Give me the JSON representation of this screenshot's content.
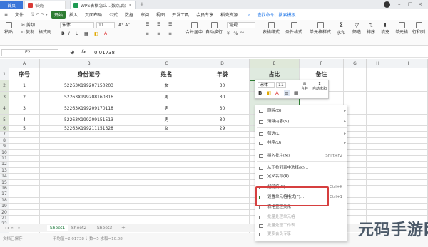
{
  "titlebar": {
    "home_tab": "首页",
    "doc_tab": "稻壳",
    "active_tab": "WPS表格怎么...数点后两位小数"
  },
  "menubar": {
    "file": "文件",
    "items": [
      "开始",
      "插入",
      "页面布局",
      "公式",
      "数据",
      "审阅",
      "视图",
      "开发工具",
      "会员专享",
      "稻壳资源"
    ],
    "active": "开始",
    "search": "查找命令、搜索模板"
  },
  "ribbon": {
    "paste": "粘贴",
    "cut": "剪切",
    "copy": "复制",
    "format_painter": "格式刷",
    "font_name": "宋体",
    "font_size": "11",
    "merge_center": "合并居中",
    "wrap_text": "自动换行",
    "number_format": "常规",
    "table_style": "表格样式",
    "cond_format": "条件格式",
    "cell_style": "单元格样式",
    "sum": "求和",
    "filter": "筛选",
    "sort": "排序",
    "fill": "填充",
    "cell": "单元格",
    "row_col": "行和列",
    "worksheet": "工作表"
  },
  "formula_bar": {
    "cell_ref": "E2",
    "fx": "fx",
    "value": "0.01738"
  },
  "grid": {
    "columns": [
      "A",
      "B",
      "C",
      "D",
      "E",
      "F",
      "G",
      "H",
      "I"
    ],
    "row_numbers": [
      "1",
      "2",
      "3",
      "4",
      "5",
      "6",
      "7",
      "8",
      "9",
      "10",
      "11",
      "12",
      "13",
      "14",
      "15",
      "16",
      "17",
      "18",
      "19",
      "20",
      "21",
      "22",
      "23"
    ],
    "headers": [
      "序号",
      "身份证号",
      "姓名",
      "年龄",
      "占比",
      "备注"
    ],
    "rows": [
      [
        "1",
        "52263X199207150203",
        "女",
        "30",
        "0."
      ],
      [
        "2",
        "52263X199208160316",
        "男",
        "30",
        ""
      ],
      [
        "3",
        "52263X199209170118",
        "男",
        "30",
        "3"
      ],
      [
        "4",
        "52263X199209151513",
        "男",
        "30",
        "4."
      ],
      [
        "5",
        "52263X199211151328",
        "女",
        "29",
        "4."
      ]
    ]
  },
  "mini_toolbar": {
    "font": "宋体",
    "size": "11",
    "merge": "合并",
    "autosum": "自动求和"
  },
  "context_menu": {
    "items": [
      {
        "label": "删除(D)",
        "key": ""
      },
      {
        "label": "清除内容(N)",
        "key": ""
      },
      {
        "label": "筛选(L)",
        "key": ""
      },
      {
        "label": "排序(U)",
        "key": ""
      },
      {
        "label": "插入批注(M)",
        "key": "Shift+F2"
      },
      {
        "label": "从下拉列表中选择(K)...",
        "key": ""
      },
      {
        "label": "定义名称(A)...",
        "key": ""
      },
      {
        "label": "超链接(H)...",
        "key": "Ctrl+K"
      },
      {
        "label": "设置单元格格式(F)...",
        "key": "Ctrl+1"
      },
      {
        "label": "表格整理美化",
        "key": ""
      },
      {
        "label": "批量处理单元格",
        "key": ""
      },
      {
        "label": "批量处理工作表",
        "key": ""
      },
      {
        "label": "更多会员专享",
        "key": ""
      }
    ]
  },
  "sheets": [
    "Sheet1",
    "Sheet2",
    "Sheet3"
  ],
  "status": {
    "autosave": "文档已保存",
    "stats": "平均值=2.01738  计数=5  求和=10.08"
  },
  "watermark": "元码手游网"
}
